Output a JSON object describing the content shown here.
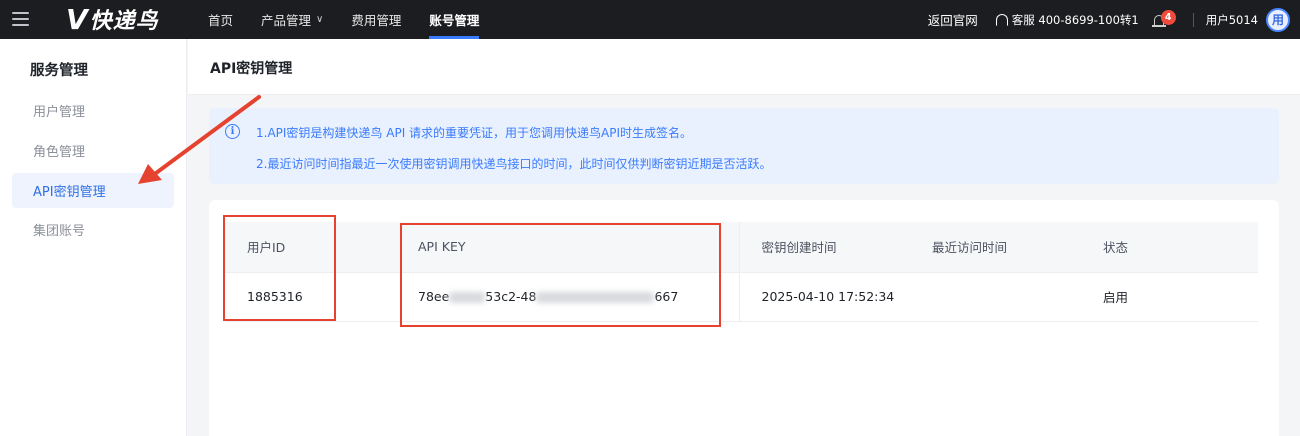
{
  "topbar": {
    "logo_v": "V",
    "logo_text": "快递鸟",
    "nav": [
      {
        "label": "首页",
        "active": false
      },
      {
        "label": "产品管理",
        "active": false,
        "dropdown": true
      },
      {
        "label": "费用管理",
        "active": false
      },
      {
        "label": "账号管理",
        "active": true
      }
    ],
    "dropdown_glyph": "∨",
    "back_label": "返回官网",
    "support_label": "客服 400-8699-100转1",
    "notification_count": "4",
    "username": "用户5014",
    "avatar_char": "用"
  },
  "sidebar": {
    "title": "服务管理",
    "items": [
      {
        "label": "用户管理",
        "active": false
      },
      {
        "label": "角色管理",
        "active": false
      },
      {
        "label": "API密钥管理",
        "active": true
      },
      {
        "label": "集团账号",
        "active": false
      }
    ]
  },
  "main": {
    "page_title": "API密钥管理",
    "info_icon": "i",
    "info_lines": [
      "1.API密钥是构建快递鸟 API 请求的重要凭证，用于您调用快递鸟API时生成签名。",
      "2.最近访问时间指最近一次使用密钥调用快递鸟接口的时间，此时间仅供判断密钥近期是否活跃。"
    ],
    "table": {
      "headers": [
        "用户ID",
        "API KEY",
        "密钥创建时间",
        "最近访问时间",
        "状态"
      ],
      "rows": [
        {
          "user_id": "1885316",
          "api_key_parts": [
            "78ee",
            "53c2-48",
            "667"
          ],
          "created_at": "2025-04-10 17:52:34",
          "last_access": "",
          "status": "启用"
        }
      ]
    }
  },
  "colors": {
    "accent": "#3a7bfd",
    "highlight_red": "#e5432f",
    "topbar_bg": "#1c1d20"
  }
}
